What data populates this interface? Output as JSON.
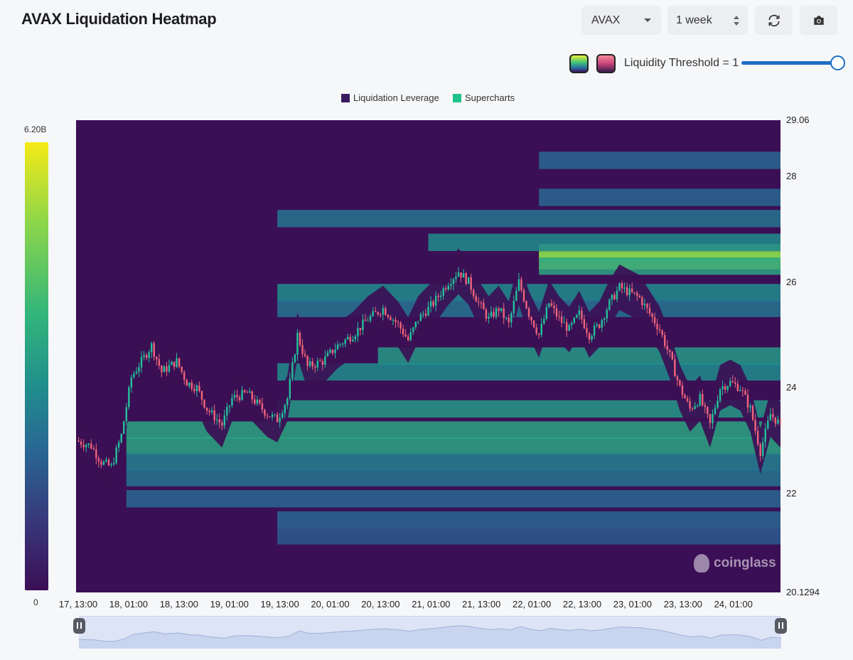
{
  "header": {
    "title": "AVAX Liquidation Heatmap"
  },
  "controls": {
    "coin": "AVAX",
    "range": "1 week",
    "refresh_icon": "refresh-icon",
    "camera_icon": "camera-icon",
    "threshold_label": "Liquidity Threshold = 1",
    "threshold_value": 1
  },
  "legend": {
    "items": [
      "Liquidation Leverage",
      "Supercharts"
    ]
  },
  "colorbar": {
    "max_label": "6.20B",
    "min_label": "0",
    "colors": [
      "#3b0f55",
      "#38367a",
      "#2a6393",
      "#208d8d",
      "#33b67a",
      "#8dd64a",
      "#f5ea17"
    ]
  },
  "watermark": "coinglass",
  "chart_data": {
    "type": "heatmap",
    "title": "AVAX Liquidation Heatmap",
    "x_tick_labels": [
      "17, 13:00",
      "18, 01:00",
      "18, 13:00",
      "19, 01:00",
      "19, 13:00",
      "20, 01:00",
      "20, 13:00",
      "21, 01:00",
      "21, 13:00",
      "22, 01:00",
      "22, 13:00",
      "23, 01:00",
      "23, 13:00",
      "24, 01:00"
    ],
    "y_tick_labels": [
      "29.06",
      "28",
      "26",
      "24",
      "22",
      "20.1294"
    ],
    "y_ticks": [
      29.06,
      28,
      26,
      24,
      22,
      20.1294
    ],
    "ylim": [
      20.1294,
      29.06
    ],
    "price_close_keypoints": [
      {
        "h": 0,
        "p": 23.0
      },
      {
        "h": 3,
        "p": 22.9
      },
      {
        "h": 5,
        "p": 22.6
      },
      {
        "h": 7,
        "p": 22.5
      },
      {
        "h": 9,
        "p": 23.1
      },
      {
        "h": 11,
        "p": 24.2
      },
      {
        "h": 13,
        "p": 24.5
      },
      {
        "h": 15,
        "p": 24.8
      },
      {
        "h": 17,
        "p": 24.3
      },
      {
        "h": 20,
        "p": 24.5
      },
      {
        "h": 22,
        "p": 24.1
      },
      {
        "h": 24,
        "p": 24.0
      },
      {
        "h": 26,
        "p": 23.6
      },
      {
        "h": 29,
        "p": 23.3
      },
      {
        "h": 31,
        "p": 23.8
      },
      {
        "h": 34,
        "p": 23.9
      },
      {
        "h": 36,
        "p": 23.7
      },
      {
        "h": 38,
        "p": 23.5
      },
      {
        "h": 40,
        "p": 23.4
      },
      {
        "h": 42,
        "p": 23.8
      },
      {
        "h": 44,
        "p": 25.0
      },
      {
        "h": 46,
        "p": 24.4
      },
      {
        "h": 49,
        "p": 24.5
      },
      {
        "h": 52,
        "p": 24.8
      },
      {
        "h": 55,
        "p": 25.0
      },
      {
        "h": 58,
        "p": 25.3
      },
      {
        "h": 61,
        "p": 25.5
      },
      {
        "h": 64,
        "p": 25.2
      },
      {
        "h": 66,
        "p": 24.9
      },
      {
        "h": 68,
        "p": 25.3
      },
      {
        "h": 71,
        "p": 25.6
      },
      {
        "h": 74,
        "p": 26.0
      },
      {
        "h": 76,
        "p": 26.2
      },
      {
        "h": 78,
        "p": 26.0
      },
      {
        "h": 80,
        "p": 25.6
      },
      {
        "h": 82,
        "p": 25.3
      },
      {
        "h": 84,
        "p": 25.5
      },
      {
        "h": 86,
        "p": 25.2
      },
      {
        "h": 88,
        "p": 26.0
      },
      {
        "h": 90,
        "p": 25.4
      },
      {
        "h": 92,
        "p": 25.0
      },
      {
        "h": 94,
        "p": 25.6
      },
      {
        "h": 96,
        "p": 25.3
      },
      {
        "h": 98,
        "p": 25.1
      },
      {
        "h": 100,
        "p": 25.4
      },
      {
        "h": 102,
        "p": 25.0
      },
      {
        "h": 104,
        "p": 25.2
      },
      {
        "h": 106,
        "p": 25.6
      },
      {
        "h": 108,
        "p": 25.9
      },
      {
        "h": 110,
        "p": 25.8
      },
      {
        "h": 112,
        "p": 25.7
      },
      {
        "h": 114,
        "p": 25.4
      },
      {
        "h": 116,
        "p": 25.1
      },
      {
        "h": 118,
        "p": 24.6
      },
      {
        "h": 120,
        "p": 24.0
      },
      {
        "h": 122,
        "p": 23.6
      },
      {
        "h": 124,
        "p": 23.8
      },
      {
        "h": 126,
        "p": 23.3
      },
      {
        "h": 128,
        "p": 24.0
      },
      {
        "h": 130,
        "p": 24.1
      },
      {
        "h": 132,
        "p": 24.0
      },
      {
        "h": 134,
        "p": 23.6
      },
      {
        "h": 136,
        "p": 22.8
      },
      {
        "h": 138,
        "p": 23.5
      },
      {
        "h": 140,
        "p": 23.3
      }
    ],
    "liquidation_bands": [
      {
        "price": 26.4,
        "intensity": 0.95,
        "from_h": 92
      },
      {
        "price": 26.55,
        "intensity": 0.8,
        "from_h": 92
      },
      {
        "price": 26.3,
        "intensity": 0.6,
        "from_h": 92
      },
      {
        "price": 26.75,
        "intensity": 0.5,
        "from_h": 70
      },
      {
        "price": 27.2,
        "intensity": 0.4,
        "from_h": 40
      },
      {
        "price": 27.6,
        "intensity": 0.35,
        "from_h": 92
      },
      {
        "price": 28.3,
        "intensity": 0.35,
        "from_h": 92
      },
      {
        "price": 25.8,
        "intensity": 0.5,
        "from_h": 40
      },
      {
        "price": 25.5,
        "intensity": 0.4,
        "from_h": 40
      },
      {
        "price": 24.6,
        "intensity": 0.55,
        "from_h": 60
      },
      {
        "price": 24.3,
        "intensity": 0.5,
        "from_h": 40
      },
      {
        "price": 23.6,
        "intensity": 0.55,
        "from_h": 40
      },
      {
        "price": 23.2,
        "intensity": 0.6,
        "from_h": 10
      },
      {
        "price": 22.9,
        "intensity": 0.6,
        "from_h": 10
      },
      {
        "price": 22.6,
        "intensity": 0.45,
        "from_h": 10
      },
      {
        "price": 22.3,
        "intensity": 0.4,
        "from_h": 10
      },
      {
        "price": 21.9,
        "intensity": 0.35,
        "from_h": 10
      },
      {
        "price": 21.5,
        "intensity": 0.35,
        "from_h": 40
      },
      {
        "price": 21.2,
        "intensity": 0.3,
        "from_h": 40
      }
    ],
    "colors": {
      "up": "#22c39b",
      "down": "#f0647a"
    }
  }
}
